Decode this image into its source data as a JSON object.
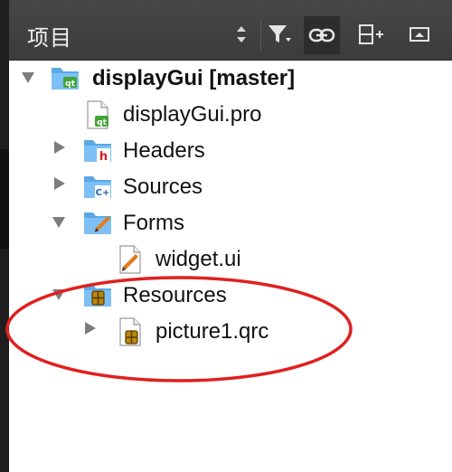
{
  "toolbar": {
    "title": "项目",
    "buttons": [
      {
        "name": "sort-updown-icon"
      },
      {
        "name": "filter-icon"
      },
      {
        "name": "link-icon"
      },
      {
        "name": "split-add-icon"
      },
      {
        "name": "window-icon"
      }
    ]
  },
  "tree": {
    "items": [
      {
        "label": "displayGui [master]",
        "icon": "qt-project-folder-icon",
        "expanded": true,
        "bold": true
      },
      {
        "label": "displayGui.pro",
        "icon": "qt-pro-file-icon"
      },
      {
        "label": "Headers",
        "icon": "headers-folder-icon",
        "expanded": false
      },
      {
        "label": "Sources",
        "icon": "sources-folder-icon",
        "expanded": false
      },
      {
        "label": "Forms",
        "icon": "forms-folder-icon",
        "expanded": true
      },
      {
        "label": "widget.ui",
        "icon": "ui-file-icon"
      },
      {
        "label": "Resources",
        "icon": "resources-folder-icon",
        "expanded": true
      },
      {
        "label": "picture1.qrc",
        "icon": "qrc-file-icon",
        "expanded": false
      }
    ]
  },
  "annotation": {
    "color": "#e02020"
  }
}
